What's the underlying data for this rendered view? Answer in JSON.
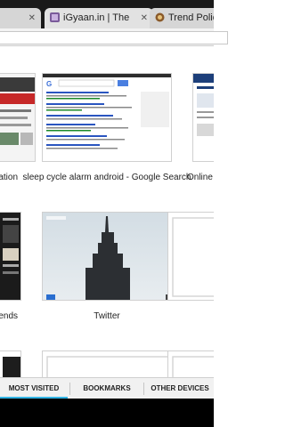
{
  "colors": {
    "accent": "#33b5e5",
    "tab_bg": "#1a1a1a"
  },
  "tabs": [
    {
      "label": "",
      "icon": "close-icon"
    },
    {
      "label": "iGyaan.in | The",
      "icon": "site-favicon"
    },
    {
      "label": "Trend Police",
      "icon": "site-favicon"
    }
  ],
  "thumbnails": [
    {
      "caption": "mation"
    },
    {
      "caption": "sleep cycle alarm android - Google Search"
    },
    {
      "caption": "Online S"
    },
    {
      "caption": "rends"
    },
    {
      "caption": "Twitter"
    },
    {
      "caption": ""
    },
    {
      "caption": ""
    },
    {
      "caption": ""
    },
    {
      "caption": ""
    }
  ],
  "bottom_tabs": [
    {
      "label": "MOST VISITED",
      "active": true
    },
    {
      "label": "BOOKMARKS",
      "active": false
    },
    {
      "label": "OTHER DEVICES",
      "active": false
    }
  ]
}
